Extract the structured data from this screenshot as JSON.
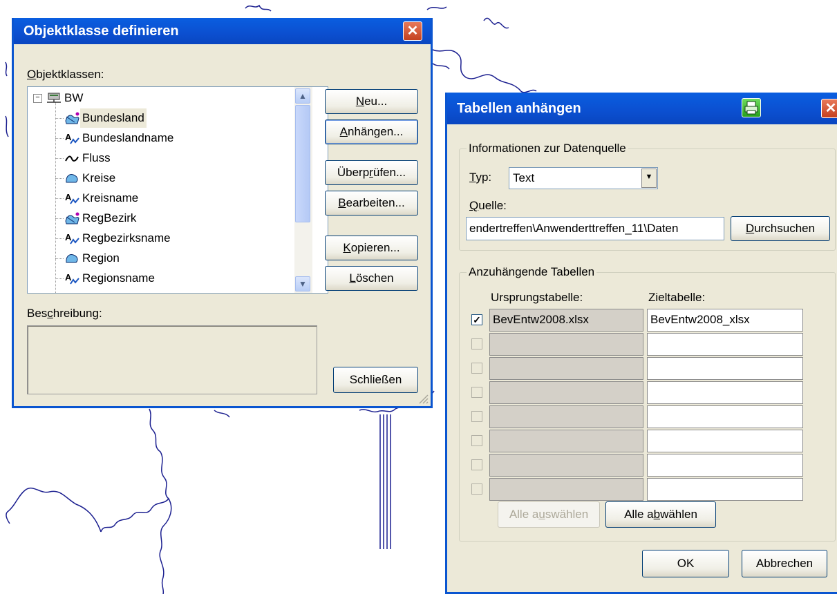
{
  "dialog1": {
    "title": "Objektklasse definieren",
    "close_symbol": "✕",
    "classes_label": {
      "prefix": "",
      "accel": "O",
      "rest": "bjektklassen:"
    },
    "tree": [
      {
        "label": "BW",
        "icon": "server-icon",
        "level": 0
      },
      {
        "label": "Bundesland",
        "icon": "area-layer-icon",
        "level": 1,
        "selected": true
      },
      {
        "label": "Bundeslandname",
        "icon": "text-layer-icon",
        "level": 1
      },
      {
        "label": "Fluss",
        "icon": "line-layer-icon",
        "level": 1
      },
      {
        "label": "Kreise",
        "icon": "polygon-layer-icon",
        "level": 1
      },
      {
        "label": "Kreisname",
        "icon": "text-layer-icon",
        "level": 1
      },
      {
        "label": "RegBezirk",
        "icon": "area-layer-icon",
        "level": 1
      },
      {
        "label": "Regbezirksname",
        "icon": "text-layer-icon",
        "level": 1
      },
      {
        "label": "Region",
        "icon": "polygon-layer-icon",
        "level": 1
      },
      {
        "label": "Regionsname",
        "icon": "text-layer-icon",
        "level": 1
      }
    ],
    "buttons": {
      "neu": {
        "prefix": "",
        "accel": "N",
        "rest": "eu..."
      },
      "anhaengen": {
        "prefix": "",
        "accel": "A",
        "rest": "nhängen..."
      },
      "ueberpruefen": {
        "prefix": "Überp",
        "accel": "r",
        "rest": "üfen..."
      },
      "bearbeiten": {
        "prefix": "",
        "accel": "B",
        "rest": "earbeiten..."
      },
      "kopieren": {
        "prefix": "",
        "accel": "K",
        "rest": "opieren..."
      },
      "loeschen": {
        "prefix": "",
        "accel": "L",
        "rest": "öschen"
      },
      "schliessen": {
        "prefix": "Schließen",
        "accel": "",
        "rest": ""
      }
    },
    "description_label": {
      "prefix": "Bes",
      "accel": "c",
      "rest": "hreibung:"
    }
  },
  "dialog2": {
    "title": "Tabellen anhängen",
    "close_symbol": "✕",
    "group_source": "Informationen zur Datenquelle",
    "typ_label": {
      "prefix": "",
      "accel": "T",
      "rest": "yp:"
    },
    "typ_value": "Text",
    "quelle_label": {
      "prefix": "",
      "accel": "Q",
      "rest": "uelle:"
    },
    "quelle_value": "endertreffen\\Anwenderttreffen_11\\Daten",
    "browse": {
      "prefix": "",
      "accel": "D",
      "rest": "urchsuchen"
    },
    "group_tables": "Anzuhängende Tabellen",
    "col_source": "Ursprungstabelle:",
    "col_target": "Zieltabelle:",
    "rows": [
      {
        "checked": true,
        "source": "BevEntw2008.xlsx",
        "target": "BevEntw2008_xlsx"
      },
      {
        "checked": false,
        "source": "",
        "target": ""
      },
      {
        "checked": false,
        "source": "",
        "target": ""
      },
      {
        "checked": false,
        "source": "",
        "target": ""
      },
      {
        "checked": false,
        "source": "",
        "target": ""
      },
      {
        "checked": false,
        "source": "",
        "target": ""
      },
      {
        "checked": false,
        "source": "",
        "target": ""
      },
      {
        "checked": false,
        "source": "",
        "target": ""
      }
    ],
    "select_all": {
      "prefix": "Alle a",
      "accel": "u",
      "rest": "swählen"
    },
    "deselect_all": {
      "prefix": "Alle a",
      "accel": "b",
      "rest": "wählen"
    },
    "ok": "OK",
    "cancel": "Abbrechen"
  },
  "colors": {
    "titlebar": "#0b52d6",
    "dialog_bg": "#ece9d8",
    "close_btn": "#d9542f",
    "map_line": "#1a1e8f",
    "printer_icon": "#2fb52a"
  }
}
